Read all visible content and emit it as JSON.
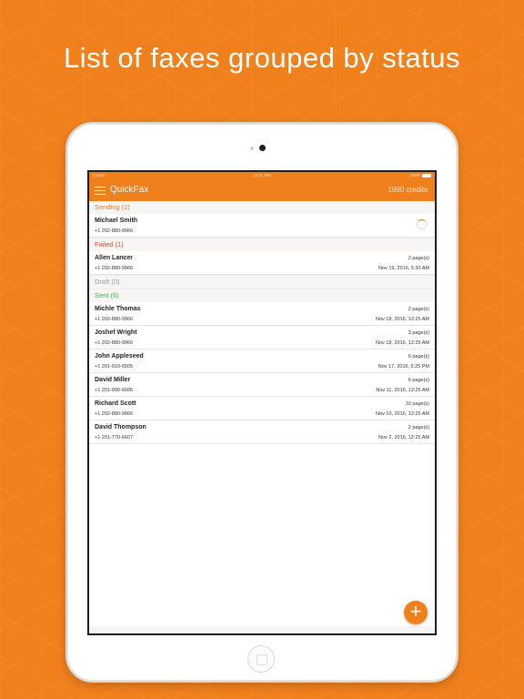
{
  "headline": "List of faxes grouped by status",
  "colors": {
    "accent": "#f0801c",
    "sending": "#f0801c",
    "failed": "#e8472b",
    "draft": "#9a9a9a",
    "sent": "#3bb34a"
  },
  "statusbar": {
    "carrier": "Carrier",
    "time": "12:31 PM",
    "battery": "100%"
  },
  "navbar": {
    "menu_icon": "hamburger-icon",
    "title": "QuickFax",
    "credits": "1990 credits"
  },
  "sections": {
    "sending": {
      "header": "Sending (1)",
      "items": [
        {
          "name": "Michael Smith",
          "phone": "+1 202-880-9966",
          "status_icon": "loading-spinner-icon"
        }
      ]
    },
    "failed": {
      "header": "Failed (1)",
      "items": [
        {
          "name": "Allen Lancer",
          "phone": "+1 202-880-9966",
          "pages": "2 page(s)",
          "date": "Nov 19, 2016, 5:30 AM"
        }
      ]
    },
    "draft": {
      "header": "Draft (0)",
      "items": []
    },
    "sent": {
      "header": "Sent (6)",
      "items": [
        {
          "name": "Michle Thomas",
          "phone": "+1 202-880-9966",
          "pages": "2 page(s)",
          "date": "Nov 18, 2016, 12:25 AM"
        },
        {
          "name": "Joshef Wright",
          "phone": "+1 202-880-9966",
          "pages": "3 page(s)",
          "date": "Nov 18, 2016, 12:25 AM"
        },
        {
          "name": "John Appleseed",
          "phone": "+1 201-910-6505",
          "pages": "6 page(s)",
          "date": "Nov 17, 2016, 6:25 PM"
        },
        {
          "name": "David Miller",
          "phone": "+1 201-990-6606",
          "pages": "6 page(s)",
          "date": "Nov 11, 2016, 12:25 AM"
        },
        {
          "name": "Richard Scott",
          "phone": "+1 202-880-9966",
          "pages": "10 page(s)",
          "date": "Nov 10, 2016, 12:25 AM"
        },
        {
          "name": "David Thompson",
          "phone": "+1 201-770-6607",
          "pages": "2 page(s)",
          "date": "Nov 2, 2016, 12:25 AM"
        }
      ]
    }
  },
  "fab": {
    "label": "+",
    "icon": "plus-icon"
  }
}
